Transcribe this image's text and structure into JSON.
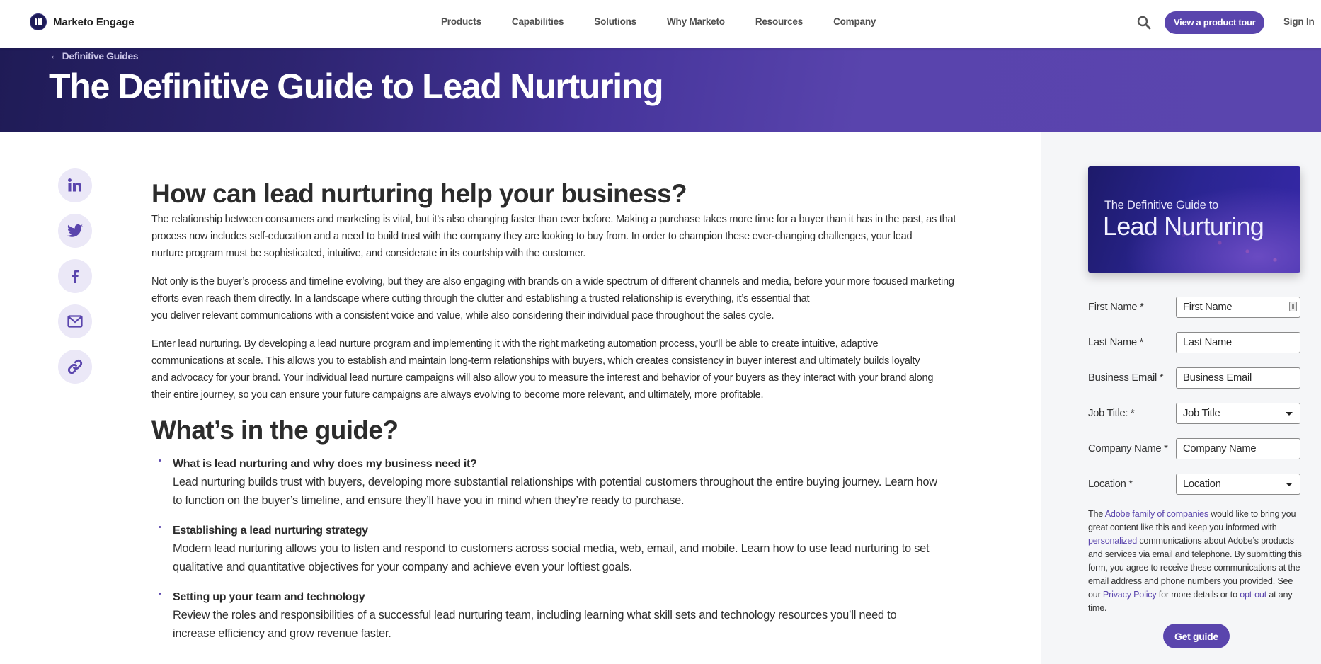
{
  "nav": {
    "brand": "Marketo Engage",
    "links": [
      "Products",
      "Capabilities",
      "Solutions",
      "Why Marketo",
      "Resources",
      "Company"
    ],
    "search_icon": "search-icon",
    "tour_button": "View a product tour",
    "sign_in": "Sign In"
  },
  "hero": {
    "back_link": "Definitive Guides",
    "title": "The Definitive Guide to Lead Nurturing",
    "colors": {
      "start": "#1f1b56",
      "end": "#5a45ae"
    }
  },
  "share": [
    {
      "name": "linkedin",
      "icon": "linkedin-icon"
    },
    {
      "name": "twitter",
      "icon": "twitter-icon"
    },
    {
      "name": "facebook",
      "icon": "facebook-icon"
    },
    {
      "name": "email",
      "icon": "envelope-icon"
    },
    {
      "name": "copy-link",
      "icon": "link-icon"
    }
  ],
  "article": {
    "heading1": "How can lead nurturing help your business?",
    "paragraphs": [
      "The relationship between consumers and marketing is vital, but it’s also changing faster than ever before. Making a purchase takes more time for a buyer than it has in the past, as that\nprocess now includes self-education and a need to build trust with the company they are looking to buy from. In order to champion these ever-changing challenges, your lead\nnurture program must be sophisticated, intuitive, and considerate in its courtship with the customer.",
      "Not only is the buyer’s process and timeline evolving, but they are also engaging with brands on a wide spectrum of different channels and media, before your more focused marketing\nefforts even reach them directly. In a landscape where cutting through the clutter and establishing a trusted relationship is everything, it’s essential that\nyou deliver relevant communications with a consistent voice and value, while also considering their individual pace throughout the sales cycle.",
      "Enter lead nurturing. By developing a lead nurture program and implementing it with the right marketing automation process, you’ll be able to create intuitive, adaptive\ncommunications at scale. This allows you to establish and maintain long-term relationships with buyers, which creates consistency in buyer interest and ultimately builds loyalty\nand advocacy for your brand. Your individual lead nurture campaigns will also allow you to measure the interest and behavior of your buyers as they interact with your brand along\ntheir entire journey, so you can ensure your future campaigns are always evolving to become more relevant, and ultimately, more profitable."
    ],
    "heading2": "What’s in the guide?",
    "items": [
      {
        "title": "What is lead nurturing and why does my business need it?",
        "desc": "Lead nurturing builds trust with buyers, developing more substantial relationships with potential customers throughout the entire buying journey. Learn how\nto function on the buyer’s timeline, and ensure they’ll have you in mind when they’re ready to purchase."
      },
      {
        "title": "Establishing a lead nurturing strategy",
        "desc": "Modern lead nurturing allows you to listen and respond to customers across social media, web, email, and mobile. Learn how to use lead nurturing to set\nqualitative and quantitative objectives for your company and achieve even your loftiest goals."
      },
      {
        "title": "Setting up your team and technology",
        "desc": "Review the roles and responsibilities of a successful lead nurturing team, including learning what skill sets and technology resources you’ll need to\nincrease efficiency and grow revenue faster."
      }
    ]
  },
  "sidebar": {
    "cover": {
      "subtitle": "The Definitive Guide to",
      "title": "Lead Nurturing"
    },
    "form": {
      "fields": [
        {
          "label": "First Name *",
          "placeholder": "First Name",
          "type": "text",
          "value": ""
        },
        {
          "label": "Last Name *",
          "placeholder": "Last Name",
          "type": "text",
          "value": ""
        },
        {
          "label": "Business Email *",
          "placeholder": "Business Email",
          "type": "email",
          "value": ""
        },
        {
          "label": "Job Title: *",
          "selected": "Job Title",
          "type": "select"
        },
        {
          "label": "Company Name *",
          "placeholder": "Company Name",
          "type": "text",
          "value": ""
        },
        {
          "label": "Location *",
          "selected": "Location",
          "type": "select"
        }
      ],
      "consent": {
        "t1": "The ",
        "link1": "Adobe family of companies",
        "t2": " would like to bring you great content like this and keep you informed with ",
        "link2": "personalized",
        "t3": " communications about Adobe’s products and services via email and telephone. By submitting this form, you agree to receive these communications at the email address and phone numbers you provided. See our ",
        "link3": "Privacy Policy",
        "t4": " for more details or to ",
        "link4": "opt-out",
        "t5": " at any time."
      },
      "submit": "Get guide"
    }
  },
  "colors": {
    "accent": "#5a45ad",
    "share_bg": "#ebe8f7",
    "sidebar_bg": "#f5f6f8",
    "text": "#2c2c2c"
  }
}
